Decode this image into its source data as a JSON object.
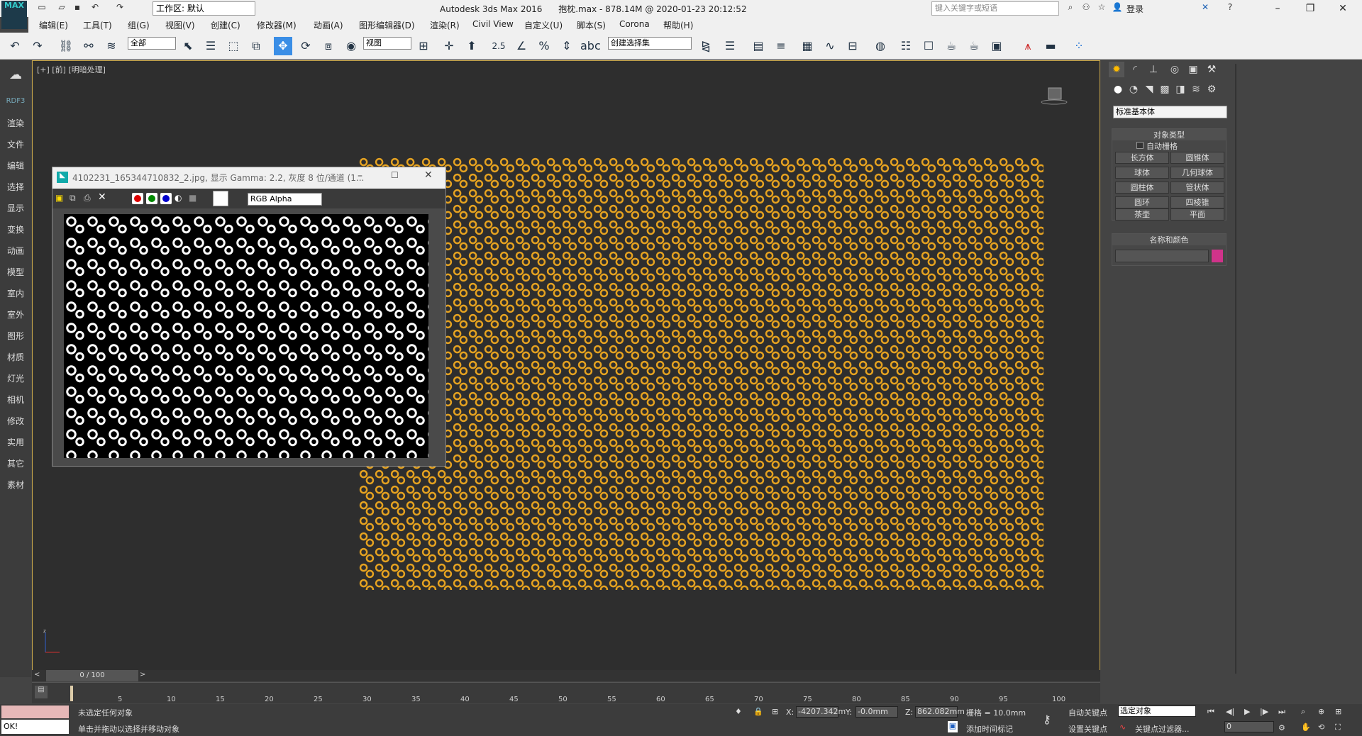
{
  "titlebar": {
    "logo": "MAX",
    "workspace": "工作区: 默认",
    "app_title": "Autodesk 3ds Max 2016      抱枕.max - 878.14M @ 2020-01-23 20:12:52",
    "search_placeholder": "键入关键字或短语",
    "login": "登录"
  },
  "menu": [
    "编辑(E)",
    "工具(T)",
    "组(G)",
    "视图(V)",
    "创建(C)",
    "修改器(M)",
    "动画(A)",
    "图形编辑器(D)",
    "渲染(R)",
    "Civil View",
    "自定义(U)",
    "脚本(S)",
    "Corona",
    "帮助(H)"
  ],
  "toolbar": {
    "filter_select": "全部",
    "view_select": "视图",
    "selection_set": "创建选择集",
    "snap_25": "2.5"
  },
  "leftstrip": [
    "RDF3",
    "渲染",
    "文件",
    "编辑",
    "选择",
    "显示",
    "变换",
    "动画",
    "模型",
    "室内",
    "室外",
    "图形",
    "材质",
    "灯光",
    "相机",
    "修改",
    "实用",
    "其它",
    "素材"
  ],
  "viewport": {
    "label": "[+] [前] [明暗处理]"
  },
  "image_window": {
    "title": "4102231_165344710832_2.jpg, 显示 Gamma: 2.2, 灰度 8 位/通道 (1...",
    "channel_select": "RGB Alpha"
  },
  "panel": {
    "primitive_type": "标准基本体",
    "object_type_title": "对象类型",
    "autogrid": "自动栅格",
    "buttons": [
      "长方体",
      "圆锥体",
      "球体",
      "几何球体",
      "圆柱体",
      "管状体",
      "圆环",
      "四棱锥",
      "茶壶",
      "平面"
    ],
    "name_color_title": "名称和颜色",
    "color_swatch": "#d0338a"
  },
  "timeline": {
    "frame_display": "0 / 100",
    "ticks": [
      "5",
      "10",
      "15",
      "20",
      "25",
      "30",
      "35",
      "40",
      "45",
      "50",
      "55",
      "60",
      "65",
      "70",
      "75",
      "80",
      "85",
      "90",
      "95",
      "100"
    ]
  },
  "status": {
    "message1": "未选定任何对象",
    "message2": "单击并拖动以选择并移动对象",
    "ok": "OK!",
    "x_label": "X:",
    "x_value": "-4207.342m",
    "y_label": "Y:",
    "y_value": "-0.0mm",
    "z_label": "Z:",
    "z_value": "862.082mm",
    "grid": "栅格 = 10.0mm",
    "autokey": "自动关键点",
    "set_key": "设置关键点",
    "selected_object": "选定对象",
    "key_filter": "关键点过滤器...",
    "add_time_tag": "添加时间标记",
    "frame_field": "0"
  }
}
